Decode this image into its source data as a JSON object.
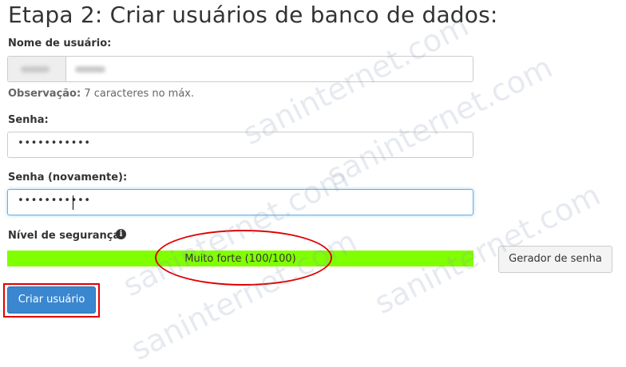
{
  "page": {
    "title": "Etapa 2: Criar usuários de banco de dados:"
  },
  "username": {
    "label": "Nome de usuário:",
    "note_bold": "Observação:",
    "note_text": " 7 caracteres no máx."
  },
  "password": {
    "label": "Senha:",
    "value": "•••••••••••"
  },
  "password_confirm": {
    "label": "Senha (novamente):",
    "value": "•••••••••••"
  },
  "strength": {
    "label": "Nível de segurança",
    "info_icon": "i",
    "text": "Muito forte (100/100)",
    "level_percent": 100,
    "color": "#80ff00"
  },
  "buttons": {
    "generator": "Gerador de senha",
    "create": "Criar usuário"
  },
  "watermark": {
    "text": "saninternet.com",
    "color": "#8ca0b9"
  },
  "annotation": {
    "color": "#e00000"
  }
}
